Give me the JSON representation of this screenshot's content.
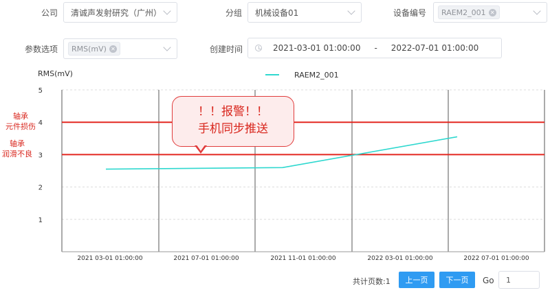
{
  "filters": {
    "company": {
      "label": "公司",
      "value": "清诚声发射研究（广州）"
    },
    "group": {
      "label": "分组",
      "value": "机械设备01"
    },
    "device": {
      "label": "设备编号",
      "tag": "RAEM2_001"
    },
    "param": {
      "label": "参数选项",
      "tag": "RMS(mV)"
    },
    "created": {
      "label": "创建时间",
      "start": "2021-03-01 01:00:00",
      "separator": "-",
      "end": "2022-07-01 01:00:00"
    }
  },
  "alarm": {
    "line1": "！！报警！！",
    "line2": "手机同步推送"
  },
  "thresholds": [
    {
      "value": 4,
      "label_line1": "轴承",
      "label_line2": "元件损伤",
      "color": "#e3261f"
    },
    {
      "value": 3,
      "label_line1": "轴承",
      "label_line2": "润滑不良",
      "color": "#e3261f"
    }
  ],
  "chart_data": {
    "type": "line",
    "ylabel": "RMS(mV)",
    "ylim": [
      0,
      5
    ],
    "yticks": [
      "1",
      "2",
      "3",
      "4",
      "5"
    ],
    "xticks": [
      "2021 03-01 01:00:00",
      "2021 07-01 01:00:00",
      "2021 11-01 01:00:00",
      "2022 03-01 01:00:00",
      "2022 07-01 01:00:00"
    ],
    "series": [
      {
        "name": "RAEM2_001",
        "color": "#2ed8cf",
        "x": [
          "2021-03-01",
          "2021-11-01",
          "2022-07-01"
        ],
        "y": [
          2.55,
          2.6,
          3.55
        ]
      }
    ],
    "grid": true,
    "legend": "top-center"
  },
  "pagination": {
    "total_label": "共计页数:1",
    "prev": "上一页",
    "next": "下一页",
    "go_label": "Go",
    "go_value": "1"
  }
}
